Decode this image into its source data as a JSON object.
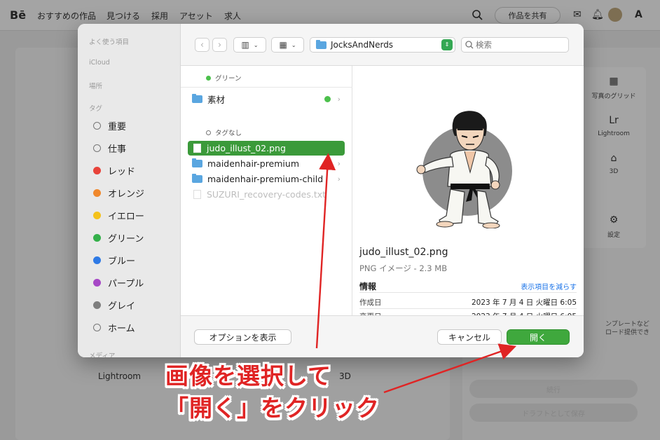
{
  "background_app": {
    "logo": "Bē",
    "nav": [
      "おすすめの作品",
      "見つける",
      "採用",
      "アセット",
      "求人"
    ],
    "share_button": "作品を共有",
    "tools": [
      "写真のグリッド",
      "Lightroom",
      "3D",
      "設定"
    ],
    "side_texts": [
      "ンプレートなど",
      "ロード提供でき"
    ],
    "bottom_labels": [
      "Lightroom",
      "3D"
    ],
    "right_side_blank_buttons": [
      "続行",
      "ドラフトとして保存"
    ]
  },
  "dialog": {
    "sidebar": {
      "sections": {
        "favorites": "よく使う項目",
        "icloud": "iCloud",
        "locations": "場所",
        "tags": "タグ",
        "media": "メディア"
      },
      "tags": [
        {
          "label": "重要",
          "color": "",
          "hollow": true
        },
        {
          "label": "仕事",
          "color": "",
          "hollow": true
        },
        {
          "label": "レッド",
          "color": "#e8433a",
          "hollow": false
        },
        {
          "label": "オレンジ",
          "color": "#f0882c",
          "hollow": false
        },
        {
          "label": "イエロー",
          "color": "#f4c21b",
          "hollow": false
        },
        {
          "label": "グリーン",
          "color": "#34b04a",
          "hollow": false
        },
        {
          "label": "ブルー",
          "color": "#2f7ae5",
          "hollow": false
        },
        {
          "label": "パープル",
          "color": "#a648c6",
          "hollow": false
        },
        {
          "label": "グレイ",
          "color": "#7e7e7e",
          "hollow": false
        },
        {
          "label": "ホーム",
          "color": "",
          "hollow": true
        }
      ]
    },
    "toolbar": {
      "back": "‹",
      "forward": "›",
      "view_mode": "▥",
      "group_mode": "▦",
      "current_folder": "JocksAndNerds",
      "search_placeholder": "検索"
    },
    "file_list": {
      "groups": [
        {
          "name": "グリーン",
          "dot_color": "#4cc04c"
        },
        {
          "name": "タグなし",
          "dot_color": ""
        }
      ],
      "items": [
        {
          "name": "素材",
          "type": "folder",
          "tag": "green"
        },
        {
          "name": "judo_illust_02.png",
          "type": "file",
          "selected": true
        },
        {
          "name": "maidenhair-premium",
          "type": "folder"
        },
        {
          "name": "maidenhair-premium-child",
          "type": "folder"
        },
        {
          "name": "SUZURI_recovery-codes.txt",
          "type": "file",
          "disabled": true
        }
      ]
    },
    "preview": {
      "file_name": "judo_illust_02.png",
      "kind_size": "PNG イメージ - 2.3 MB",
      "info_heading": "情報",
      "show_less": "表示項目を減らす",
      "rows": [
        {
          "label": "作成日",
          "value": "2023 年 7 月 4 日 火曜日 6:05"
        },
        {
          "label": "変更日",
          "value": "2023 年 7 月 4 日 火曜日 6:05"
        }
      ]
    },
    "footer": {
      "options_button": "オプションを表示",
      "cancel_button": "キャンセル",
      "open_button": "開く"
    }
  },
  "annotation": {
    "line1": "画像を選択して",
    "line2": "「開く」をクリック",
    "color": "#e02424"
  }
}
